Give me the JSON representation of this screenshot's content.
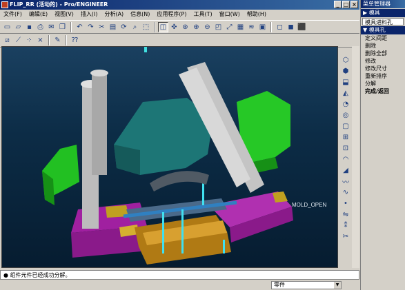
{
  "window": {
    "title": "FLIP_RR (活动的) - Pro/ENGINEER",
    "buttons": [
      "_",
      "□",
      "×"
    ]
  },
  "menu": [
    "文件(F)",
    "编辑(E)",
    "视图(V)",
    "插入(I)",
    "分析(A)",
    "信息(N)",
    "应用程序(P)",
    "工具(T)",
    "窗口(W)",
    "帮助(H)"
  ],
  "viewport": {
    "label": "MOLD_OPEN"
  },
  "messages": {
    "text": "● 组件元件已经成功分解。"
  },
  "status": {
    "filter": "零件"
  },
  "menu_manager": {
    "title": "菜单管理器",
    "section1": "▶ 模具",
    "selector": "模具进料孔",
    "section2": "▼ 模具孔",
    "items": [
      "定义间距",
      "删除",
      "删除全部",
      "修改",
      "修改尺寸",
      "重新排序",
      "分解"
    ],
    "done": "完成/返回"
  },
  "colors": {
    "viewport_bg_top": "#1a4060",
    "viewport_bg_bottom": "#061c30",
    "title_bar": "#0a246a",
    "mold_green": "#2ecc2e",
    "plate_magenta": "#b020b0",
    "core_teal": "#1f7a7a",
    "base_orange": "#c08a1a",
    "pin_gray": "#c8c8c8"
  }
}
